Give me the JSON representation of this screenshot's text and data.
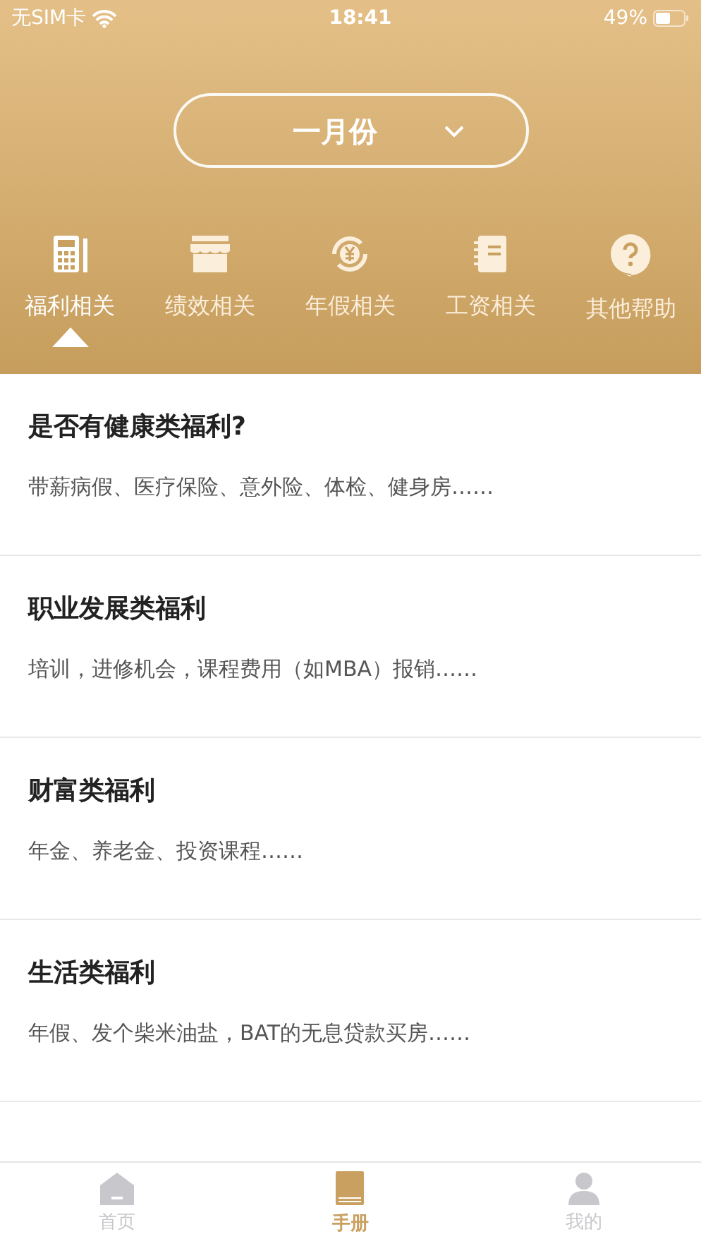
{
  "status_bar": {
    "carrier": "无SIM卡",
    "time": "18:41",
    "battery": "49%"
  },
  "month_picker": {
    "value": "一月份"
  },
  "tabs": [
    {
      "label": "福利相关",
      "selected": true
    },
    {
      "label": "绩效相关",
      "selected": false
    },
    {
      "label": "年假相关",
      "selected": false
    },
    {
      "label": "工资相关",
      "selected": false
    },
    {
      "label": "其他帮助",
      "selected": false
    }
  ],
  "items": [
    {
      "title": "是否有健康类福利?",
      "summary": "带薪病假、医疗保险、意外险、体检、健身房……"
    },
    {
      "title": "职业发展类福利",
      "summary": "培训，进修机会，课程费用（如MBA）报销……"
    },
    {
      "title": "财富类福利",
      "summary": "年金、养老金、投资课程……"
    },
    {
      "title": "生活类福利",
      "summary": "年假、发个柴米油盐，BAT的无息贷款买房……"
    }
  ],
  "tab_bar": [
    {
      "label": "首页",
      "selected": false
    },
    {
      "label": "手册",
      "selected": true
    },
    {
      "label": "我的",
      "selected": false
    }
  ]
}
